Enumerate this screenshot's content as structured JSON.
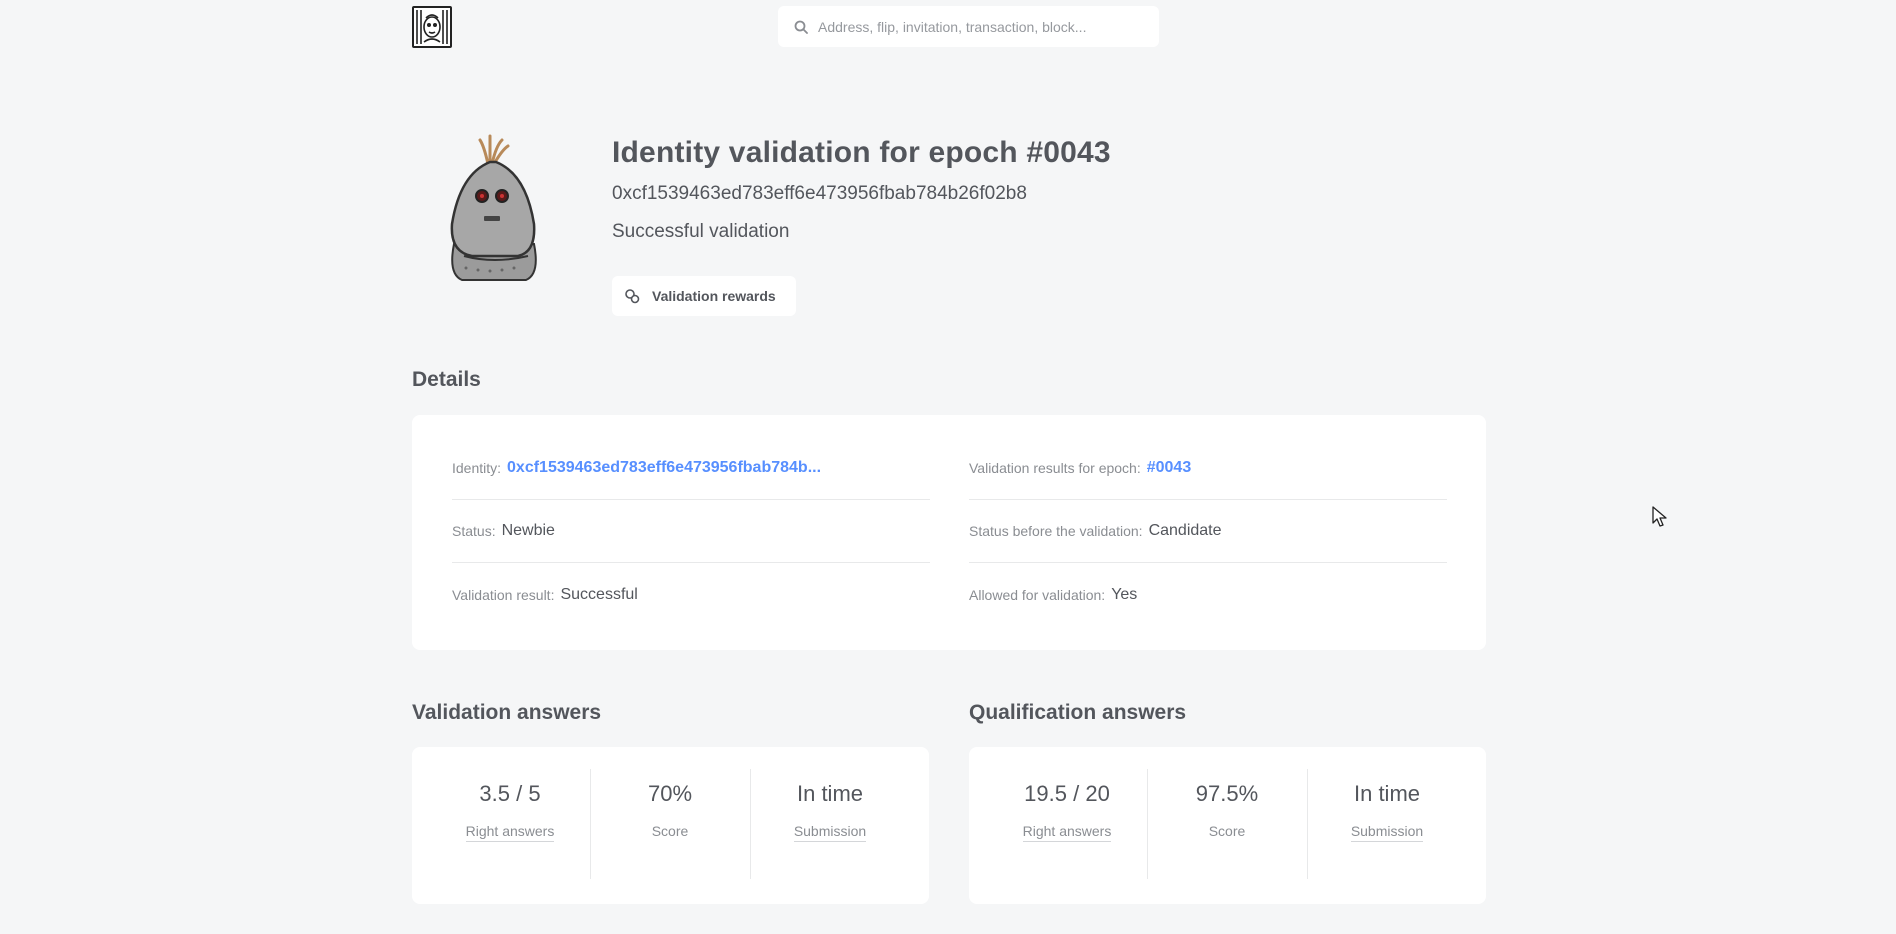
{
  "header": {
    "search_placeholder": "Address, flip, invitation, transaction, block..."
  },
  "hero": {
    "title": "Identity validation for epoch #0043",
    "address": "0xcf1539463ed783eff6e473956fbab784b26f02b8",
    "status": "Successful validation",
    "rewards_button": "Validation rewards"
  },
  "details": {
    "heading": "Details",
    "identity_label": "Identity:",
    "identity_value": "0xcf1539463ed783eff6e473956fbab784b...",
    "epoch_label": "Validation results for epoch:",
    "epoch_value": "#0043",
    "status_label": "Status:",
    "status_value": "Newbie",
    "status_before_label": "Status before the validation:",
    "status_before_value": "Candidate",
    "result_label": "Validation result:",
    "result_value": "Successful",
    "allowed_label": "Allowed for validation:",
    "allowed_value": "Yes"
  },
  "validation_answers": {
    "heading": "Validation answers",
    "right_answers": "3.5 / 5",
    "right_answers_label": "Right answers",
    "score": "70%",
    "score_label": "Score",
    "submission": "In time",
    "submission_label": "Submission"
  },
  "qualification_answers": {
    "heading": "Qualification answers",
    "right_answers": "19.5 / 20",
    "right_answers_label": "Right answers",
    "score": "97.5%",
    "score_label": "Score",
    "submission": "In time",
    "submission_label": "Submission"
  },
  "colors": {
    "background": "#f5f6f7",
    "card": "#ffffff",
    "text": "#53565c",
    "muted": "#8a8d92",
    "link": "#578fff"
  },
  "icons": [
    "logo-icon",
    "search-icon",
    "coins-icon",
    "robot-avatar",
    "mouse-cursor-icon"
  ]
}
